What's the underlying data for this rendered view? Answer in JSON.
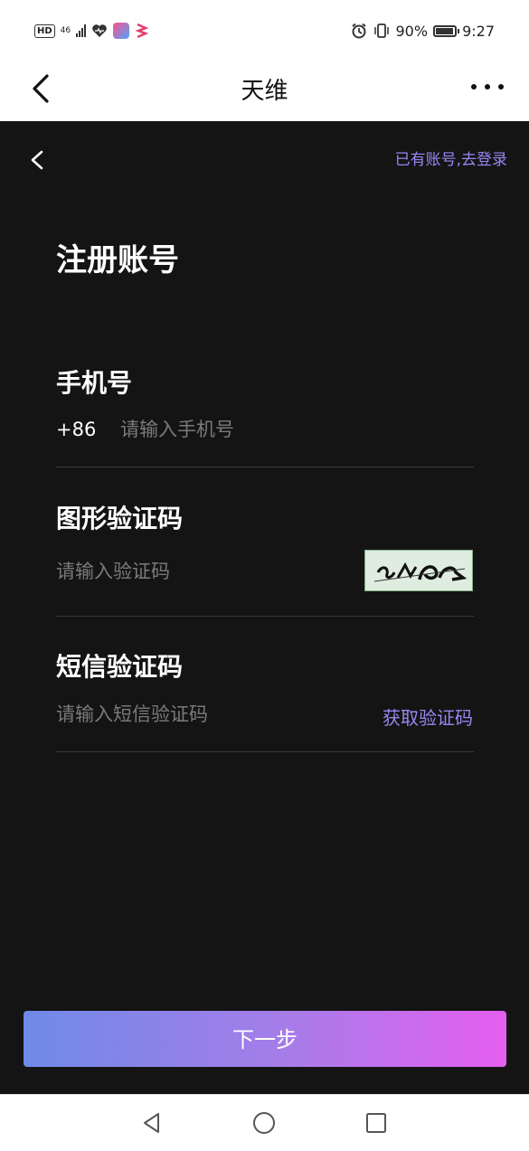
{
  "status_bar": {
    "hd": "HD",
    "network": "46",
    "battery_percent_text": "90%",
    "battery_level": 0.9,
    "time": "9:27",
    "icons": [
      "heart-icon",
      "app-icon",
      "app-icon",
      "alarm-icon",
      "vibrate-icon",
      "battery-icon"
    ]
  },
  "header": {
    "title": "天维",
    "back_icon": "chevron-left-icon",
    "more_icon": "more-horizontal-icon"
  },
  "page": {
    "login_link": "已有账号,去登录",
    "title": "注册账号",
    "phone": {
      "label": "手机号",
      "prefix": "+86",
      "placeholder": "请输入手机号",
      "value": ""
    },
    "captcha": {
      "label": "图形验证码",
      "placeholder": "请输入验证码",
      "value": "",
      "image": "captcha-image"
    },
    "sms": {
      "label": "短信验证码",
      "placeholder": "请输入短信验证码",
      "value": "",
      "get_code": "获取验证码"
    },
    "next_button": "下一步"
  },
  "colors": {
    "background": "#141414",
    "accent": "#9a86f2",
    "gradient_start": "#6f8ae8",
    "gradient_end": "#e55ff0"
  },
  "nav_bar": {
    "icons": [
      "back-triangle-icon",
      "home-circle-icon",
      "recents-square-icon"
    ]
  }
}
